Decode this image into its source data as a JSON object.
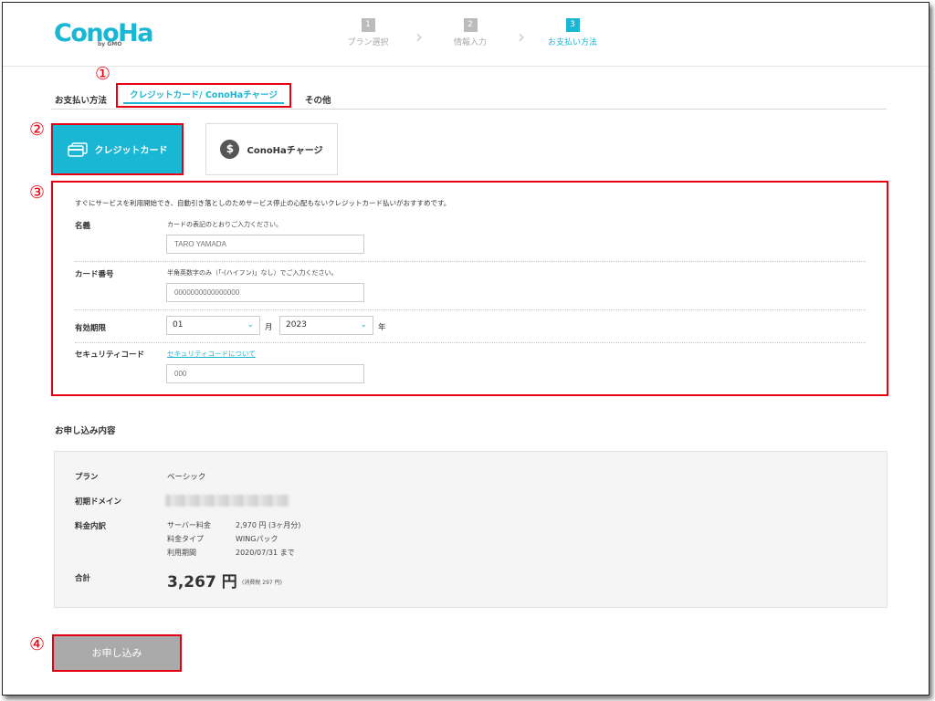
{
  "header": {
    "logo": "ConoHa",
    "logo_sub": "by GMO",
    "steps": [
      {
        "num": "1",
        "label": "プラン選択"
      },
      {
        "num": "2",
        "label": "情報入力"
      },
      {
        "num": "3",
        "label": "お支払い方法"
      }
    ],
    "active_step": 3
  },
  "annotations": [
    "①",
    "②",
    "③",
    "④"
  ],
  "tabs": {
    "section_label": "お支払い方法",
    "items": [
      {
        "label": "クレジットカード/ ConoHaチャージ",
        "active": true
      },
      {
        "label": "その他",
        "active": false
      }
    ]
  },
  "methods": {
    "card_label": "クレジットカード",
    "charge_label": "ConoHaチャージ",
    "charge_icon_glyph": "$"
  },
  "form": {
    "intro": "すぐにサービスを利用開始でき、自動引き落としのためサービス停止の心配もないクレジットカード払いがおすすめです。",
    "name": {
      "label": "名義",
      "hint": "カードの表記のとおりご入力ください。",
      "placeholder": "TARO YAMADA"
    },
    "card_number": {
      "label": "カード番号",
      "hint": "半角英数字のみ（「-(ハイフン)」なし）でご入力ください。",
      "placeholder": "0000000000000000"
    },
    "expiry": {
      "label": "有効期限",
      "month": "01",
      "month_unit": "月",
      "year": "2023",
      "year_unit": "年"
    },
    "security": {
      "label": "セキュリティコード",
      "link": "セキュリティコードについて",
      "placeholder": "000"
    }
  },
  "summary": {
    "title": "お申し込み内容",
    "plan_label": "プラン",
    "plan_value": "ベーシック",
    "domain_label": "初期ドメイン",
    "fee_label": "料金内訳",
    "fees": [
      {
        "k": "サーバー料金",
        "v": "2,970 円 (3ヶ月分)"
      },
      {
        "k": "料金タイプ",
        "v": "WINGパック"
      },
      {
        "k": "利用期間",
        "v": "2020/07/31 まで"
      }
    ],
    "total_label": "合計",
    "total_value": "3,267 円",
    "tax_note": "(消費税 297 円)"
  },
  "submit_label": "お申し込み",
  "colors": {
    "accent": "#1ab7d4",
    "highlight": "#e60012",
    "disabled": "#aaaaaa"
  }
}
